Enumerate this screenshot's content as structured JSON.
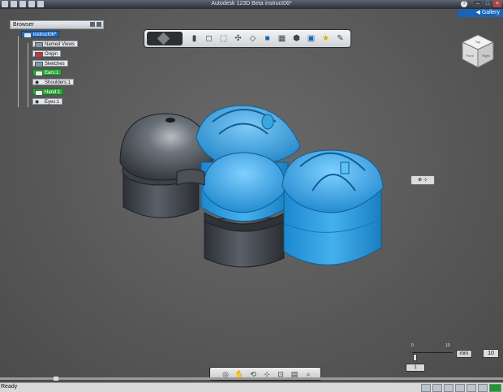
{
  "window": {
    "title": "Autodesk 123D Beta    instruct06*",
    "help": "?"
  },
  "gallery": {
    "label": "Gallery",
    "arrow": "◀"
  },
  "browser": {
    "title": "Browser",
    "items": [
      {
        "label": "instruct06*",
        "style": "root"
      },
      {
        "label": "Named Views",
        "style": "plain"
      },
      {
        "label": "Origin",
        "style": "plain"
      },
      {
        "label": "Sketches",
        "style": "plain"
      },
      {
        "label": "Ears:1",
        "style": "green"
      },
      {
        "label": "Shoulders:1",
        "style": "plain"
      },
      {
        "label": "Hand:1",
        "style": "green"
      },
      {
        "label": "Eyes:1",
        "style": "plain"
      }
    ]
  },
  "toolbar": {
    "tools": [
      "primitives-icon",
      "box-icon",
      "extrude-icon",
      "pattern-icon",
      "modify-icon",
      "combine-icon",
      "group-icon",
      "measure-icon",
      "3d-print-icon",
      "material-icon",
      "sketch-icon"
    ]
  },
  "viewcube": {
    "top": "Top",
    "front": "Front",
    "right": "Right"
  },
  "scale": {
    "min_label": "0",
    "max_label": "10",
    "unit": "mm",
    "value": "10",
    "step": "1"
  },
  "status": {
    "text": "Ready"
  },
  "colors": {
    "viewport_bg": "#5b5b5b",
    "selection_blue": "#2f9fe3",
    "model_gray": "#454a50",
    "browser_root": "#1a70c8",
    "browser_visible": "#29a835"
  }
}
